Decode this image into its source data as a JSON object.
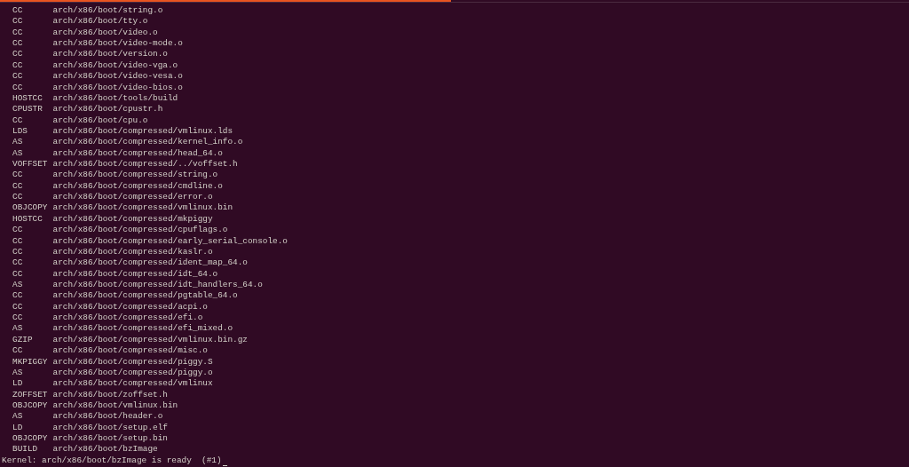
{
  "lines": [
    {
      "tag": "CC",
      "path": "arch/x86/boot/string.o"
    },
    {
      "tag": "CC",
      "path": "arch/x86/boot/tty.o"
    },
    {
      "tag": "CC",
      "path": "arch/x86/boot/video.o"
    },
    {
      "tag": "CC",
      "path": "arch/x86/boot/video-mode.o"
    },
    {
      "tag": "CC",
      "path": "arch/x86/boot/version.o"
    },
    {
      "tag": "CC",
      "path": "arch/x86/boot/video-vga.o"
    },
    {
      "tag": "CC",
      "path": "arch/x86/boot/video-vesa.o"
    },
    {
      "tag": "CC",
      "path": "arch/x86/boot/video-bios.o"
    },
    {
      "tag": "HOSTCC",
      "path": "arch/x86/boot/tools/build"
    },
    {
      "tag": "CPUSTR",
      "path": "arch/x86/boot/cpustr.h"
    },
    {
      "tag": "CC",
      "path": "arch/x86/boot/cpu.o"
    },
    {
      "tag": "LDS",
      "path": "arch/x86/boot/compressed/vmlinux.lds"
    },
    {
      "tag": "AS",
      "path": "arch/x86/boot/compressed/kernel_info.o"
    },
    {
      "tag": "AS",
      "path": "arch/x86/boot/compressed/head_64.o"
    },
    {
      "tag": "VOFFSET",
      "path": "arch/x86/boot/compressed/../voffset.h"
    },
    {
      "tag": "CC",
      "path": "arch/x86/boot/compressed/string.o"
    },
    {
      "tag": "CC",
      "path": "arch/x86/boot/compressed/cmdline.o"
    },
    {
      "tag": "CC",
      "path": "arch/x86/boot/compressed/error.o"
    },
    {
      "tag": "OBJCOPY",
      "path": "arch/x86/boot/compressed/vmlinux.bin"
    },
    {
      "tag": "HOSTCC",
      "path": "arch/x86/boot/compressed/mkpiggy"
    },
    {
      "tag": "CC",
      "path": "arch/x86/boot/compressed/cpuflags.o"
    },
    {
      "tag": "CC",
      "path": "arch/x86/boot/compressed/early_serial_console.o"
    },
    {
      "tag": "CC",
      "path": "arch/x86/boot/compressed/kaslr.o"
    },
    {
      "tag": "CC",
      "path": "arch/x86/boot/compressed/ident_map_64.o"
    },
    {
      "tag": "CC",
      "path": "arch/x86/boot/compressed/idt_64.o"
    },
    {
      "tag": "AS",
      "path": "arch/x86/boot/compressed/idt_handlers_64.o"
    },
    {
      "tag": "CC",
      "path": "arch/x86/boot/compressed/pgtable_64.o"
    },
    {
      "tag": "CC",
      "path": "arch/x86/boot/compressed/acpi.o"
    },
    {
      "tag": "CC",
      "path": "arch/x86/boot/compressed/efi.o"
    },
    {
      "tag": "AS",
      "path": "arch/x86/boot/compressed/efi_mixed.o"
    },
    {
      "tag": "GZIP",
      "path": "arch/x86/boot/compressed/vmlinux.bin.gz"
    },
    {
      "tag": "CC",
      "path": "arch/x86/boot/compressed/misc.o"
    },
    {
      "tag": "MKPIGGY",
      "path": "arch/x86/boot/compressed/piggy.S"
    },
    {
      "tag": "AS",
      "path": "arch/x86/boot/compressed/piggy.o"
    },
    {
      "tag": "LD",
      "path": "arch/x86/boot/compressed/vmlinux"
    },
    {
      "tag": "ZOFFSET",
      "path": "arch/x86/boot/zoffset.h"
    },
    {
      "tag": "OBJCOPY",
      "path": "arch/x86/boot/vmlinux.bin"
    },
    {
      "tag": "AS",
      "path": "arch/x86/boot/header.o"
    },
    {
      "tag": "LD",
      "path": "arch/x86/boot/setup.elf"
    },
    {
      "tag": "OBJCOPY",
      "path": "arch/x86/boot/setup.bin"
    },
    {
      "tag": "BUILD",
      "path": "arch/x86/boot/bzImage"
    }
  ],
  "final_line": "Kernel: arch/x86/boot/bzImage is ready  (#1)"
}
